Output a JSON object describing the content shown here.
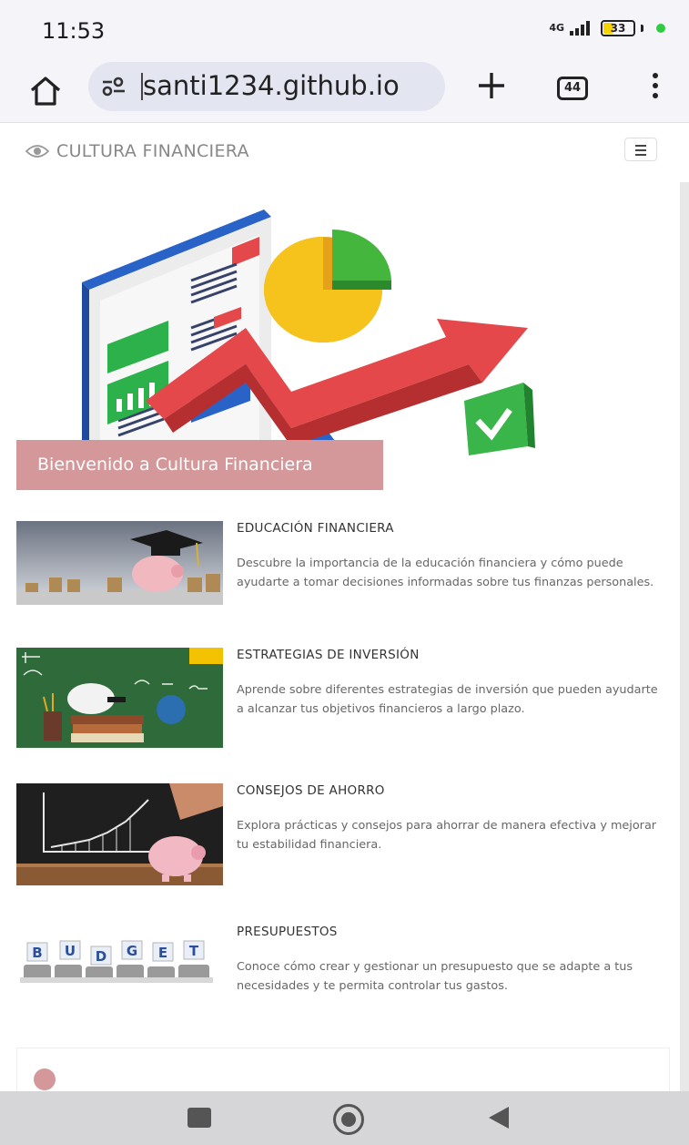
{
  "status_bar": {
    "time": "11:53",
    "network": "4G",
    "battery": "33",
    "dot_color": "#2ecc40"
  },
  "browser": {
    "url": "santi1234.github.io",
    "tab_count": "44",
    "icons": [
      "home-icon",
      "site-settings-icon",
      "plus-icon",
      "tabs-icon",
      "more-vert-icon"
    ]
  },
  "site": {
    "brand": "CULTURA FINANCIERA",
    "brand_icon": "eye-icon",
    "hero_banner": "Bienvenido a Cultura Financiera",
    "accent": "#d4989a"
  },
  "cards": [
    {
      "title": "EDUCACIÓN FINANCIERA",
      "text": "Descubre la importancia de la educación financiera y cómo puede ayudarte a tomar decisiones informadas sobre tus finanzas personales."
    },
    {
      "title": "ESTRATEGIAS DE INVERSIÓN",
      "text": "Aprende sobre diferentes estrategias de inversión que pueden ayudarte a alcanzar tus objetivos financieros a largo plazo."
    },
    {
      "title": "CONSEJOS DE AHORRO",
      "text": "Explora prácticas y consejos para ahorrar de manera efectiva y mejorar tu estabilidad financiera."
    },
    {
      "title": "PRESUPUESTOS",
      "text": "Conoce cómo crear y gestionar un presupuesto que se adapte a tus necesidades y te permita controlar tus gastos."
    }
  ],
  "budget_letters": [
    "B",
    "U",
    "D",
    "G",
    "E",
    "T"
  ]
}
